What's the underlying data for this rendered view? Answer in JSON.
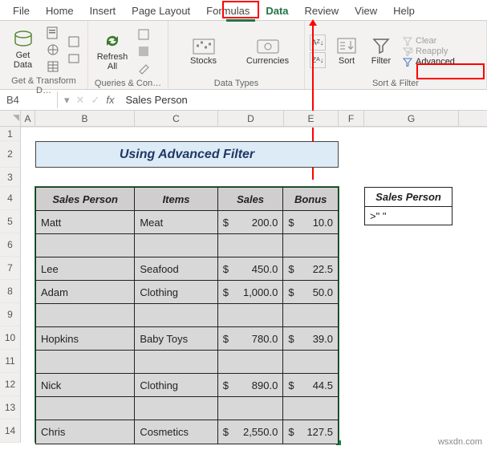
{
  "tabs": {
    "file": "File",
    "home": "Home",
    "insert": "Insert",
    "pagelayout": "Page Layout",
    "formulas": "Formulas",
    "data": "Data",
    "review": "Review",
    "view": "View",
    "help": "Help"
  },
  "ribbon": {
    "get_data": "Get\nData",
    "refresh": "Refresh\nAll",
    "stocks": "Stocks",
    "currencies": "Currencies",
    "sort_az": "A→Z",
    "sort_za": "Z→A",
    "sort": "Sort",
    "filter": "Filter",
    "clear": "Clear",
    "reapply": "Reapply",
    "advanced": "Advanced",
    "group_gettransform": "Get & Transform D…",
    "group_queries": "Queries & Con…",
    "group_datatypes": "Data Types",
    "group_sortfilter": "Sort & Filter"
  },
  "formula_bar": {
    "namebox": "B4",
    "dropdown_glyph": "▾",
    "cancel_glyph": "✕",
    "confirm_glyph": "✓",
    "fx": "fx",
    "value": "Sales Person"
  },
  "columns": [
    "A",
    "B",
    "C",
    "D",
    "E",
    "F",
    "G"
  ],
  "rows": [
    "1",
    "2",
    "3",
    "4",
    "5",
    "6",
    "7",
    "8",
    "9",
    "10",
    "11",
    "12",
    "13",
    "14"
  ],
  "title": "Using Advanced Filter",
  "table": {
    "headers": {
      "person": "Sales Person",
      "items": "Items",
      "sales": "Sales",
      "bonus": "Bonus"
    },
    "rows": [
      {
        "person": "Matt",
        "items": "Meat",
        "sales": "200.0",
        "bonus": "10.0"
      },
      {
        "person": "",
        "items": "",
        "sales": "",
        "bonus": ""
      },
      {
        "person": "Lee",
        "items": "Seafood",
        "sales": "450.0",
        "bonus": "22.5"
      },
      {
        "person": "Adam",
        "items": "Clothing",
        "sales": "1,000.0",
        "bonus": "50.0"
      },
      {
        "person": "",
        "items": "",
        "sales": "",
        "bonus": ""
      },
      {
        "person": "Hopkins",
        "items": "Baby Toys",
        "sales": "780.0",
        "bonus": "39.0"
      },
      {
        "person": "",
        "items": "",
        "sales": "",
        "bonus": ""
      },
      {
        "person": "Nick",
        "items": "Clothing",
        "sales": "890.0",
        "bonus": "44.5"
      },
      {
        "person": "",
        "items": "",
        "sales": "",
        "bonus": ""
      },
      {
        "person": "Chris",
        "items": "Cosmetics",
        "sales": "2,550.0",
        "bonus": "127.5"
      }
    ],
    "currency": "$"
  },
  "criteria": {
    "header": "Sales Person",
    "value": ">\" \""
  },
  "watermark": "wsxdn.com"
}
